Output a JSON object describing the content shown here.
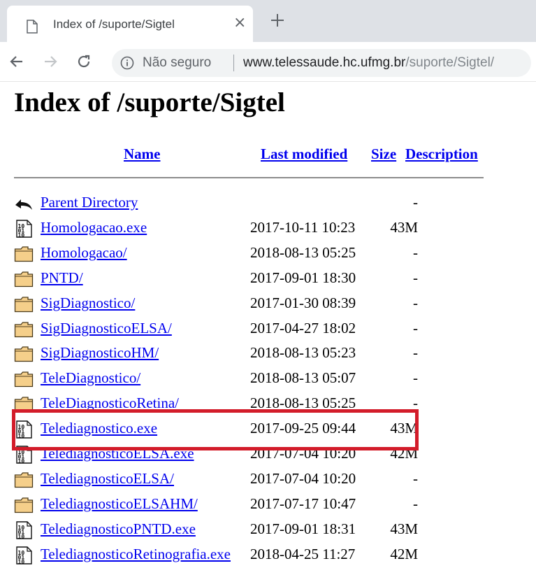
{
  "browser": {
    "tab_title": "Index of /suporte/Sigtel",
    "close_glyph": "×",
    "security_label": "Não seguro",
    "url_host": "www.telessaude.hc.ufmg.br",
    "url_path": "/suporte/Sigtel/"
  },
  "page": {
    "title": "Index of /suporte/Sigtel",
    "columns": {
      "name": "Name",
      "last_modified": "Last modified",
      "size": "Size",
      "description": "Description"
    },
    "rows": [
      {
        "name": "Parent Directory",
        "date": "",
        "size": "-",
        "icon": "back-arrow-icon"
      },
      {
        "name": "Homologacao.exe",
        "date": "2017-10-11 10:23",
        "size": "43M",
        "icon": "binary-file-icon"
      },
      {
        "name": "Homologacao/",
        "date": "2018-08-13 05:25",
        "size": "-",
        "icon": "folder-icon"
      },
      {
        "name": "PNTD/",
        "date": "2017-09-01 18:30",
        "size": "-",
        "icon": "folder-icon"
      },
      {
        "name": "SigDiagnostico/",
        "date": "2017-01-30 08:39",
        "size": "-",
        "icon": "folder-icon"
      },
      {
        "name": "SigDiagnosticoELSA/",
        "date": "2017-04-27 18:02",
        "size": "-",
        "icon": "folder-icon"
      },
      {
        "name": "SigDiagnosticoHM/",
        "date": "2018-08-13 05:23",
        "size": "-",
        "icon": "folder-icon"
      },
      {
        "name": "TeleDiagnostico/",
        "date": "2018-08-13 05:07",
        "size": "-",
        "icon": "folder-icon"
      },
      {
        "name": "TeleDiagnosticoRetina/",
        "date": "2018-08-13 05:25",
        "size": "-",
        "icon": "folder-icon"
      },
      {
        "name": "Telediagnostico.exe",
        "date": "2017-09-25 09:44",
        "size": "43M",
        "icon": "binary-file-icon",
        "highlighted": true
      },
      {
        "name": "TelediagnosticoELSA.exe",
        "date": "2017-07-04 10:20",
        "size": "42M",
        "icon": "binary-file-icon"
      },
      {
        "name": "TelediagnosticoELSA/",
        "date": "2017-07-04 10:20",
        "size": "-",
        "icon": "folder-icon"
      },
      {
        "name": "TelediagnosticoELSAHM/",
        "date": "2017-07-17 10:47",
        "size": "-",
        "icon": "folder-icon"
      },
      {
        "name": "TelediagnosticoPNTD.exe",
        "date": "2017-09-01 18:31",
        "size": "43M",
        "icon": "binary-file-icon"
      },
      {
        "name": "TelediagnosticoRetinografia.exe",
        "date": "2018-04-25 11:27",
        "size": "42M",
        "icon": "binary-file-icon"
      }
    ]
  },
  "colors": {
    "link": "#0000ee",
    "highlight_border": "#d31c2a",
    "folder_fill": "#f5cf8a"
  }
}
